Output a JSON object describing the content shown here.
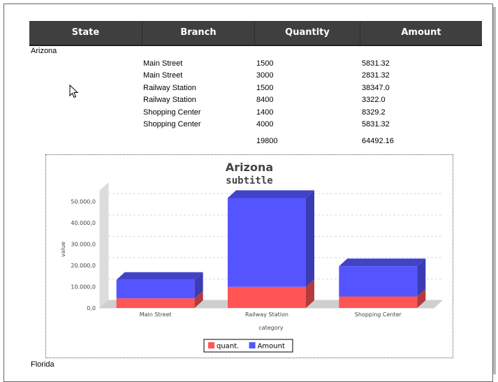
{
  "table": {
    "headers": [
      "State",
      "Branch",
      "Quantity",
      "Amount"
    ]
  },
  "groups": [
    {
      "state": "Arizona",
      "rows": [
        {
          "branch": "Main Street",
          "quantity": "1500",
          "amount": "5831.32"
        },
        {
          "branch": "Main Street",
          "quantity": "3000",
          "amount": "2831.32"
        },
        {
          "branch": "Railway Station",
          "quantity": "1500",
          "amount": "38347.0"
        },
        {
          "branch": "Railway Station",
          "quantity": "8400",
          "amount": "3322.0"
        },
        {
          "branch": "Shopping Center",
          "quantity": "1400",
          "amount": "8329.2"
        },
        {
          "branch": "Shopping Center",
          "quantity": "4000",
          "amount": "5831.32"
        }
      ],
      "total_quantity": "19800",
      "total_amount": "64492.16"
    },
    {
      "state": "Florida"
    }
  ],
  "colors": {
    "header_bg": "#3f3f3f",
    "quant_series": "#ff5555",
    "amount_series": "#5555ff"
  },
  "chart_data": {
    "type": "bar",
    "stacked": true,
    "style": "3d",
    "title": "Arizona",
    "subtitle": "subtitle",
    "xlabel": "category",
    "ylabel": "value",
    "categories": [
      "Main Street",
      "Railway Station",
      "Shopping Center"
    ],
    "series": [
      {
        "name": "quant.",
        "color": "#ff5555",
        "values": [
          4500,
          9900,
          5400
        ]
      },
      {
        "name": "Amount",
        "color": "#5555ff",
        "values": [
          8662.64,
          41669.0,
          14160.52
        ]
      }
    ],
    "ylim": [
      0,
      55000
    ],
    "yticks": [
      0,
      10000,
      20000,
      30000,
      40000,
      50000
    ],
    "ytick_labels": [
      "0,0",
      "10.000,0",
      "20.000,0",
      "30.000,0",
      "40.000,0",
      "50.000,0"
    ],
    "grid": true,
    "legend": "bottom-center"
  }
}
